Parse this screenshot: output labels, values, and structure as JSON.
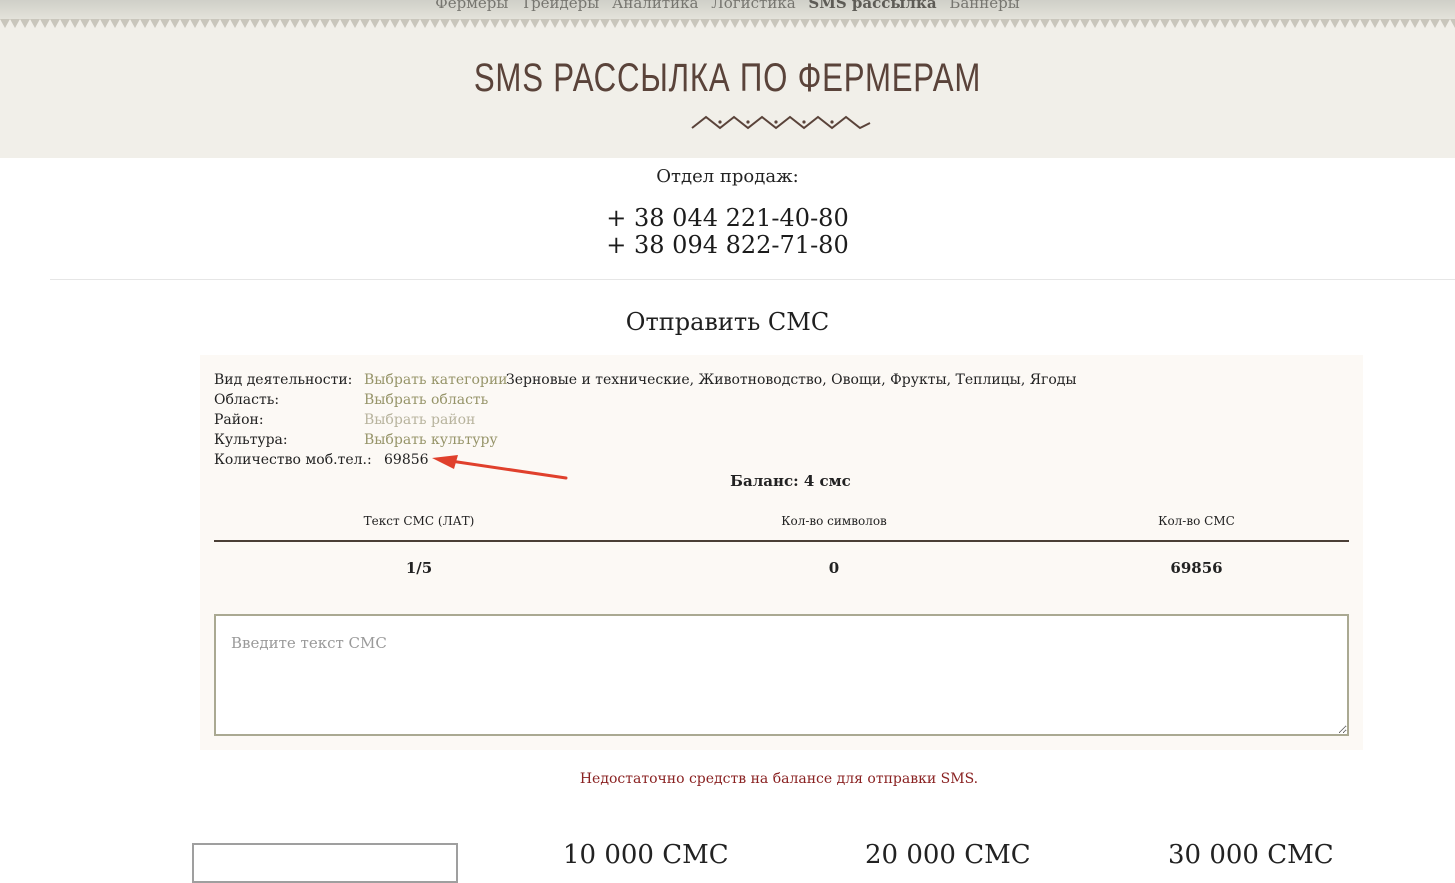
{
  "nav": {
    "items": [
      "Фермеры",
      "Трейдеры",
      "Аналитика",
      "Логистика",
      "SMS рассылка",
      "Баннеры"
    ],
    "active": "SMS рассылка"
  },
  "header": {
    "title": "SMS РАССЫЛКА ПО ФЕРМЕРАМ"
  },
  "contact": {
    "title": "Отдел продаж:",
    "phone1": "+ 38 044 221-40-80",
    "phone2": "+ 38 094 822-71-80"
  },
  "form": {
    "title": "Отправить СМС",
    "activity_label": "Вид деятельности:",
    "activity_link": "Выбрать категории",
    "activity_value": "Зерновые и технические, Животноводство, Овощи, Фрукты, Теплицы, Ягоды",
    "region_label": "Область:",
    "region_link": "Выбрать область",
    "district_label": "Район:",
    "district_link": "Выбрать район",
    "culture_label": "Культура:",
    "culture_link": "Выбрать культуру",
    "phones_label": "Количество моб.тел.:",
    "phones_count": "69856",
    "balance": "Баланс: 4 смс"
  },
  "table": {
    "headers": [
      "Текст СМС  (ЛАТ)",
      "Кол-во символов",
      "Кол-во СМС"
    ],
    "row": [
      "1/5",
      "0",
      "69856"
    ]
  },
  "message": {
    "placeholder": "Введите текст СМС",
    "value": ""
  },
  "warning": "Недостаточно средств на балансе для отправки SMS.",
  "packages": [
    "10 000 СМС",
    "20 000 СМС",
    "30 000 СМС"
  ],
  "colors": {
    "accent": "#969469",
    "title": "#5a433a",
    "warning": "#8a2222",
    "arrow": "#e0402c"
  }
}
